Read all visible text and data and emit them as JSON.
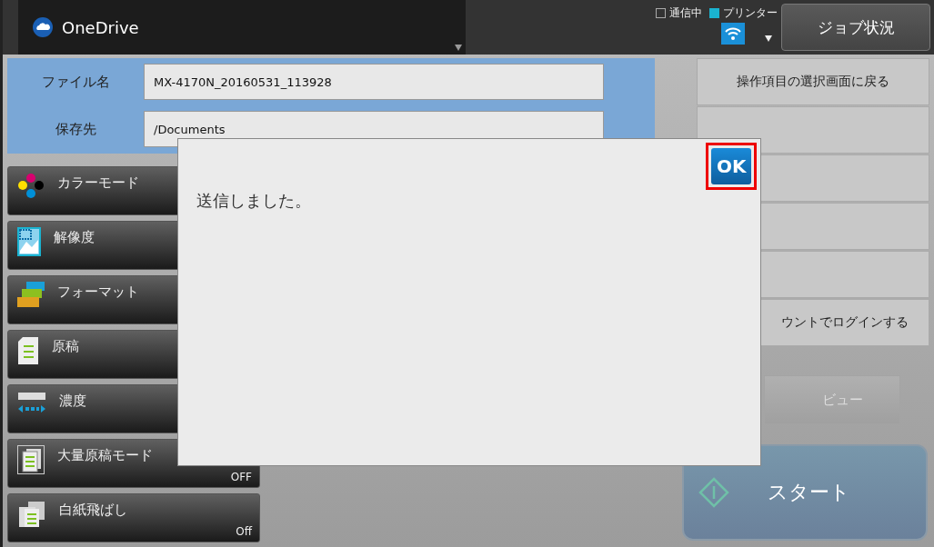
{
  "header": {
    "app_title": "OneDrive",
    "status": [
      {
        "label": "通信中",
        "checked": false
      },
      {
        "label": "プリンター",
        "checked": true
      }
    ],
    "job_button": "ジョブ状況"
  },
  "file_fields": [
    {
      "label": "ファイル名",
      "value": "MX-4170N_20160531_113928"
    },
    {
      "label": "保存先",
      "value": "/Documents"
    }
  ],
  "settings": [
    {
      "kind": "color",
      "label": "カラーモード"
    },
    {
      "kind": "resolution",
      "label": "解像度"
    },
    {
      "kind": "format",
      "label": "フォーマット"
    },
    {
      "kind": "original",
      "label": "原稿"
    },
    {
      "kind": "exposure",
      "label": "濃度"
    },
    {
      "kind": "bulk",
      "label": "大量原稿モード",
      "value": "OFF"
    },
    {
      "kind": "blank",
      "label": "白紙飛ばし",
      "value": "Off"
    }
  ],
  "side_buttons": {
    "top": "操作項目の選択画面に戻る",
    "bottom": "ウントでログインする"
  },
  "preview_button": "ビュー",
  "start_button": "スタート",
  "dialog": {
    "message": "送信しました。",
    "ok": "OK",
    "ok_highlighted": true
  }
}
